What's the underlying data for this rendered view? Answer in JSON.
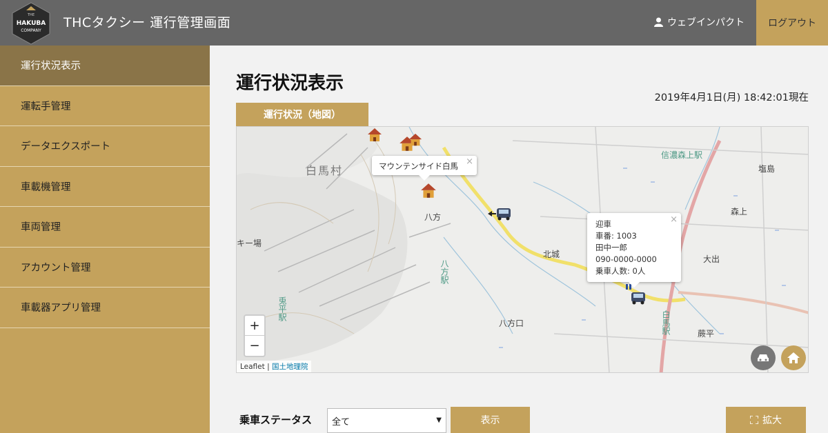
{
  "header": {
    "logo": {
      "line1": "THE",
      "line2": "HAKUBA",
      "line3": "COMPANY"
    },
    "title": "THCタクシー 運行管理画面",
    "user_name": "ウェブインパクト",
    "logout_label": "ログアウト"
  },
  "sidebar": {
    "items": [
      {
        "label": "運行状況表示"
      },
      {
        "label": "運転手管理"
      },
      {
        "label": "データエクスポート"
      },
      {
        "label": "車載機管理"
      },
      {
        "label": "車両管理"
      },
      {
        "label": "アカウント管理"
      },
      {
        "label": "車載器アプリ管理"
      }
    ]
  },
  "main": {
    "title": "運行状況表示",
    "datetime": "2019年4月1日(月) 18:42:01現在",
    "map_tab": "運行状況（地図）"
  },
  "map": {
    "labels": {
      "hakuba_village": "白馬村",
      "shinano_moriue_station": "信濃森上駅",
      "shiojima": "塩島",
      "happo": "八方",
      "ski_area": "キー場",
      "happo_station": "八方駅",
      "hokujo": "北城",
      "moriue": "森上",
      "oode": "大出",
      "usagidaira_station": "兎平駅",
      "happo_guchi": "八方口",
      "hakuba_station": "白馬駅",
      "warabidaira": "蕨平"
    },
    "hotel_popup": {
      "text": "マウンテンサイド白馬",
      "close": "×"
    },
    "vehicle_popup": {
      "lines": [
        "迎車",
        "車番: 1003",
        "田中一郎",
        "090-0000-0000",
        "乗車人数: 0人"
      ],
      "close": "×"
    },
    "zoom_in": "+",
    "zoom_out": "−",
    "attribution_leaflet": "Leaflet",
    "attribution_separator": " | ",
    "attribution_gsi": "国土地理院"
  },
  "filters": {
    "status_label": "乗車ステータス",
    "status_selected": "全て",
    "show_label": "表示",
    "expand_label": "拡大"
  },
  "colors": {
    "header_bg": "#666666",
    "accent_gold": "#c4a25c",
    "nav_active": "#8a7448",
    "vehicle_btn": "#777777"
  }
}
